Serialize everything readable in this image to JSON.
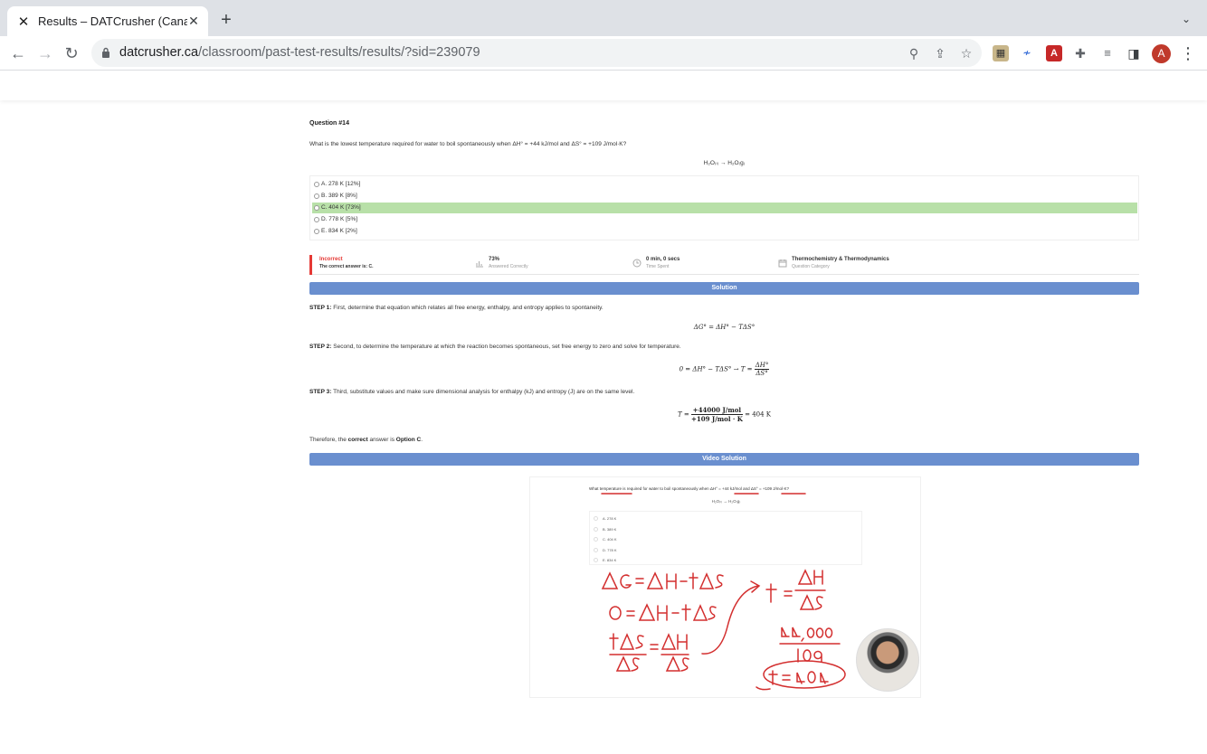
{
  "browser": {
    "tab_title": "Results – DATCrusher (Canadian",
    "url_host": "datcrusher.ca",
    "url_path": "/classroom/past-test-results/results/?sid=239079",
    "avatar_letter": "A",
    "icons": [
      "back-arrow-icon",
      "forward-arrow-icon",
      "reload-icon",
      "lock-icon",
      "zoom-icon",
      "share-icon",
      "star-icon",
      "extensions-icon",
      "reading-list-icon",
      "side-panel-icon",
      "kebab-menu-icon"
    ]
  },
  "question": {
    "title": "Question #14",
    "text": "What is the lowest temperature required for water to boil spontaneously when ΔH° = +44 kJ/mol and ΔS° = +109 J/mol·K?",
    "reaction": "H₂O₍ₗ₎ → H₂O₍g₎",
    "options": [
      {
        "label": "A. 278 K [12%]",
        "correct": false
      },
      {
        "label": "B. 389 K [8%]",
        "correct": false
      },
      {
        "label": "C. 404 K [73%]",
        "correct": true
      },
      {
        "label": "D. 778 K [5%]",
        "correct": false
      },
      {
        "label": "E. 834 K [2%]",
        "correct": false
      }
    ],
    "colors": {
      "correct_bg": "#b8e0a8",
      "incorrect": "#e53935",
      "banner": "#6a8fcf"
    }
  },
  "result": {
    "status": "Incorrect",
    "correct_answer": "The correct answer is: C.",
    "percent": "73%",
    "percent_label": "Answered Correctly",
    "time": "0 min, 0 secs",
    "time_label": "Time Spent",
    "category": "Thermochemistry & Thermodynamics",
    "category_label": "Question Category"
  },
  "solution": {
    "banner": "Solution",
    "step1_label": "STEP 1:",
    "step1_text": " First, determine that equation which relates all free energy, enthalpy, and entropy applies to spontaneity.",
    "eq1": "ΔG° = ΔH° − TΔS°",
    "step2_label": "STEP 2:",
    "step2_text": " Second, to determine the temperature at which the reaction becomes spontaneous, set free energy to zero and solve for temperature.",
    "eq2_left": "0 = ΔH° − TΔS° → T =",
    "eq2_num": "ΔH°",
    "eq2_den": "ΔS°",
    "step3_label": "STEP 3:",
    "step3_text": " Third, substitute values and make sure dimensional analysis for enthalpy (kJ) and entropy (J) are on the same level.",
    "eq3_left": "T =",
    "eq3_num": "+44000 J/mol",
    "eq3_den": "+109 J/mol · K",
    "eq3_right": "= 404 K",
    "conclusion_pre": "Therefore, the ",
    "conclusion_bold": "correct",
    "conclusion_mid": " answer is ",
    "conclusion_option": "Option C",
    "conclusion_end": "."
  },
  "video": {
    "banner": "Video Solution",
    "question": "What temperature is required for water to boil spontaneously when ΔH° = +44 kJ/mol and ΔS° = +109 J/mol·K?",
    "reaction": "H₂O₍ₗ₎ → H₂O₍g₎",
    "options": [
      "A. 278 K",
      "B. 389 K",
      "C. 404 K",
      "D. 778 K",
      "E. 834 K"
    ],
    "ink_color": "#d32f2f"
  }
}
